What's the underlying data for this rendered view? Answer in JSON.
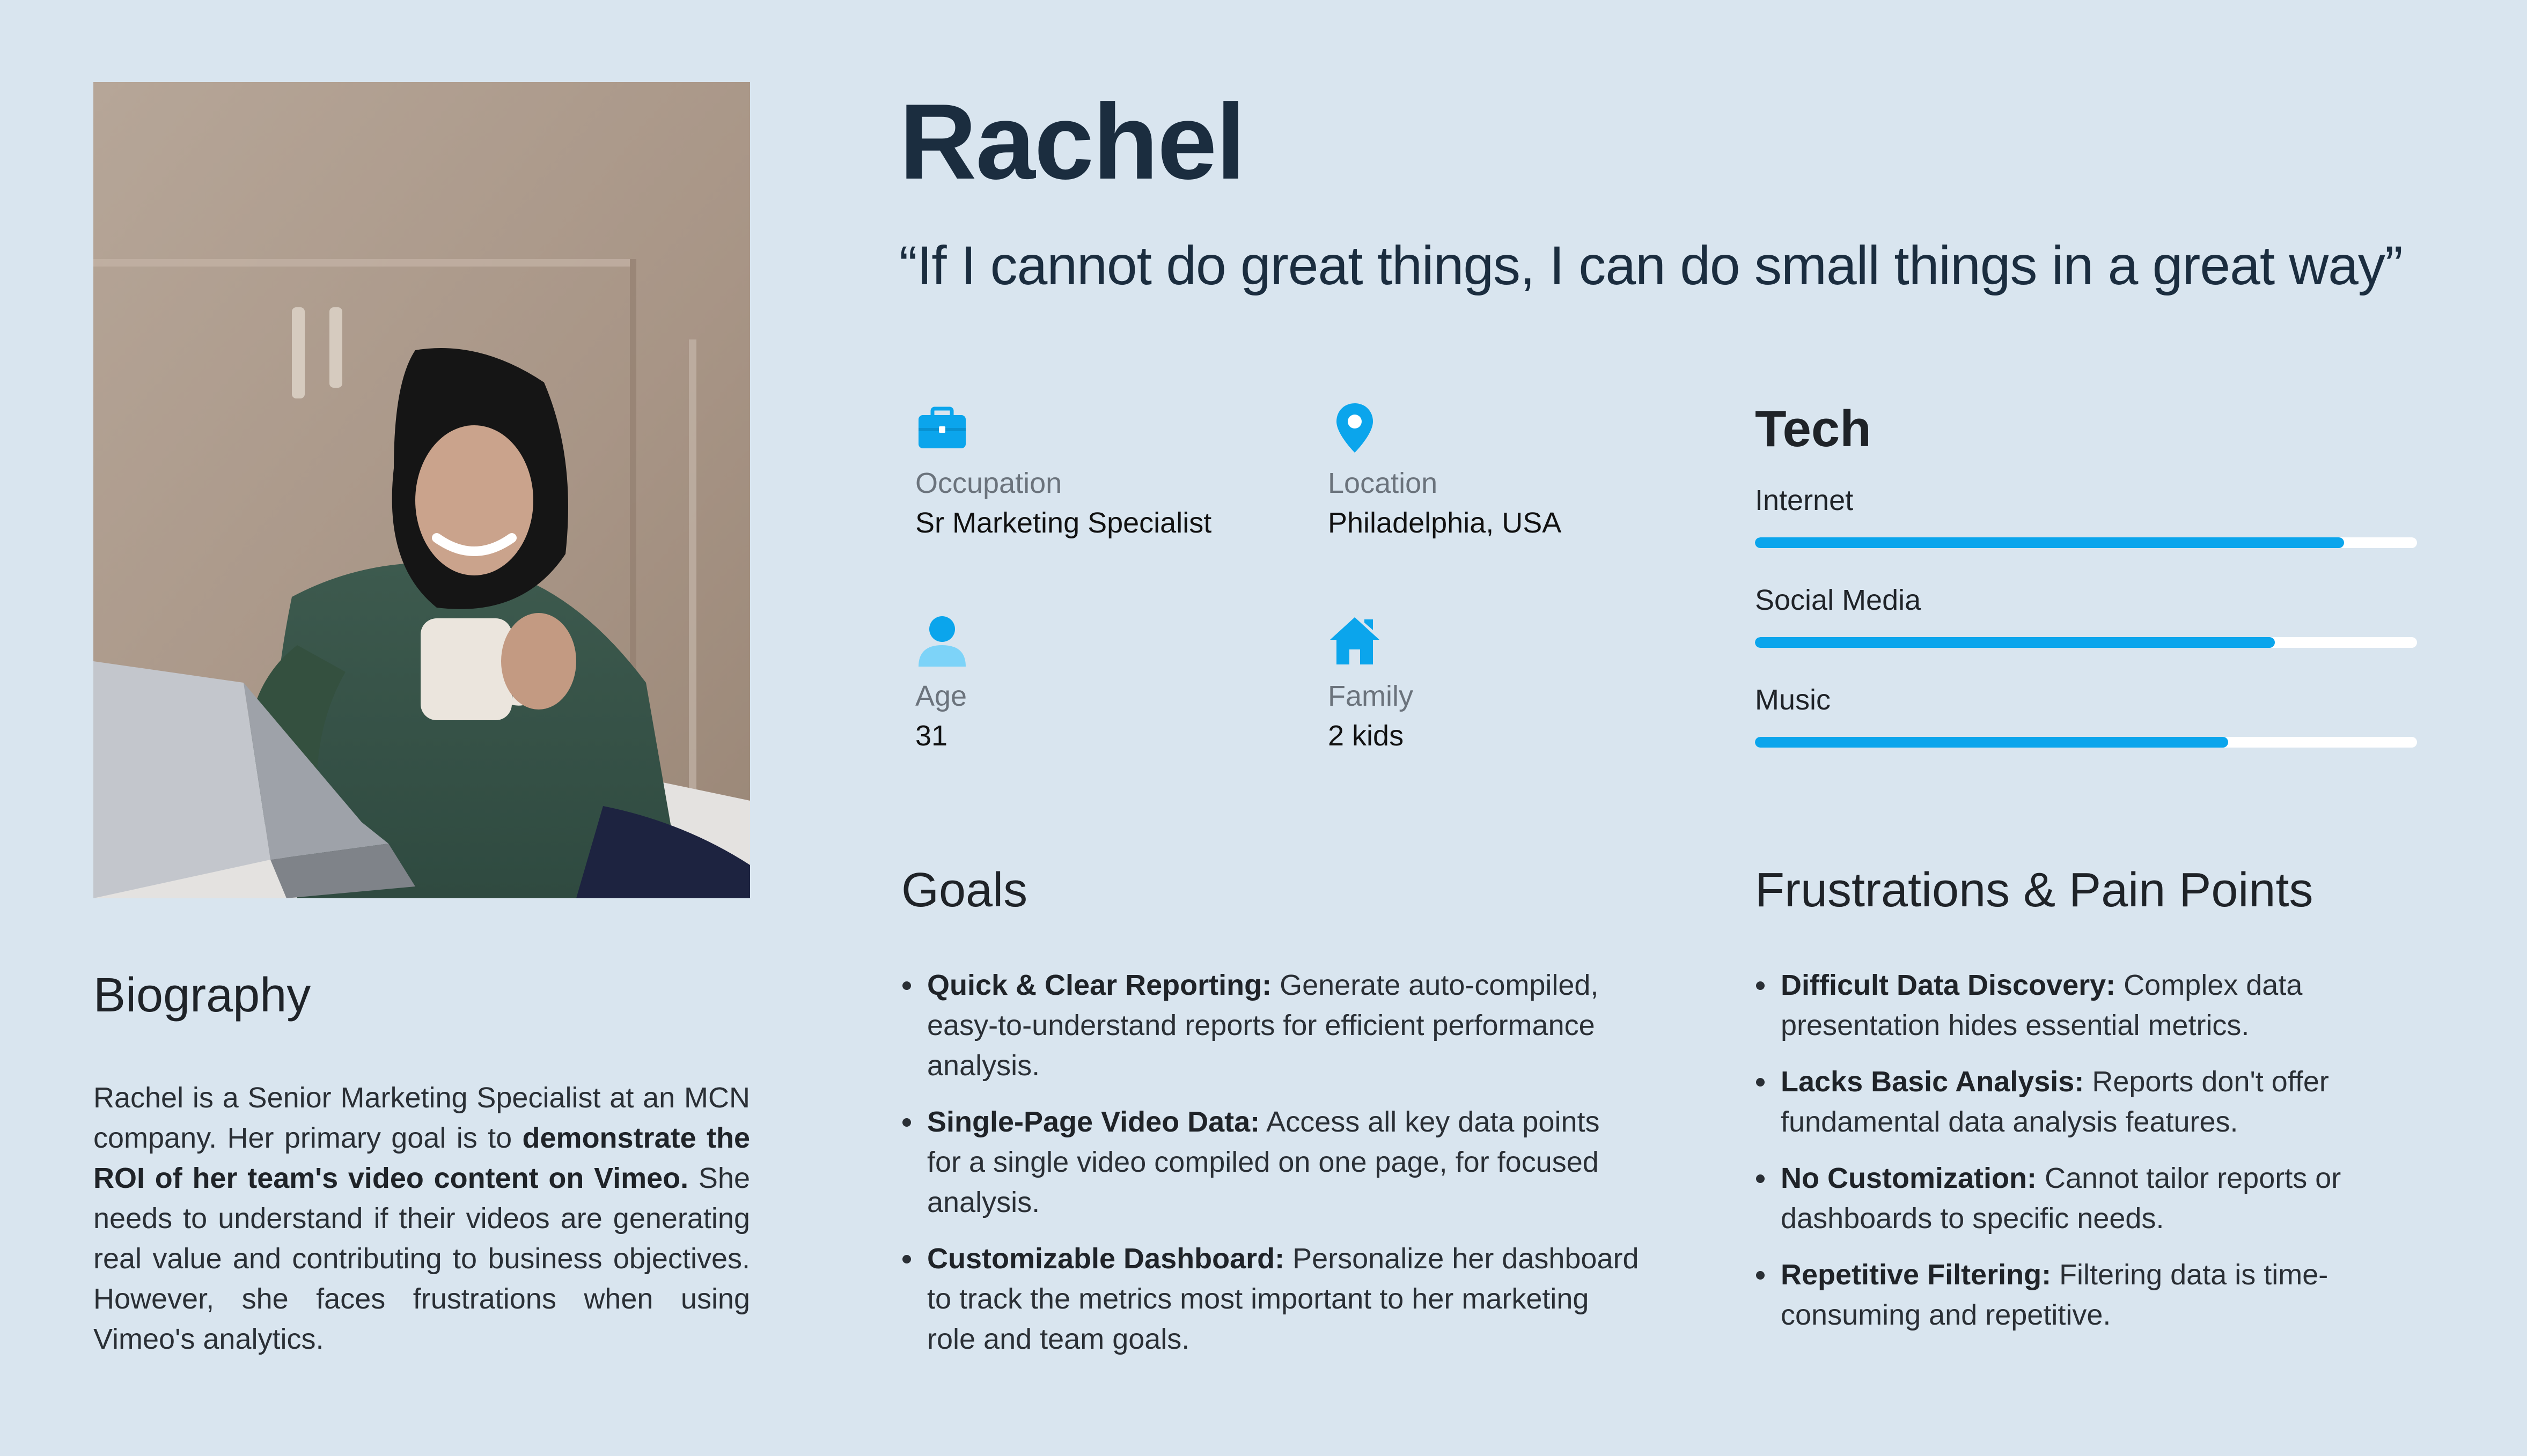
{
  "persona": {
    "name": "Rachel",
    "quote": "“If I cannot do great things, I can do small things in a great way”"
  },
  "info": {
    "occupation": {
      "icon": "briefcase-icon",
      "label": "Occupation",
      "value": "Sr Marketing Specialist"
    },
    "location": {
      "icon": "map-pin-icon",
      "label": "Location",
      "value": "Philadelphia, USA"
    },
    "age": {
      "icon": "person-icon",
      "label": "Age",
      "value": "31"
    },
    "family": {
      "icon": "home-icon",
      "label": "Family",
      "value": "2 kids"
    }
  },
  "tech": {
    "title": "Tech",
    "items": [
      {
        "label": "Internet",
        "level": 0.89
      },
      {
        "label": "Social Media",
        "level": 0.785
      },
      {
        "label": "Music",
        "level": 0.715
      }
    ]
  },
  "biography": {
    "title": "Biography",
    "text_1": "Rachel is a Senior Marketing Specialist at an MCN company.  Her primary goal is to ",
    "text_bold": "demonstrate the ROI of her team's video content on Vimeo.",
    "text_2": " She needs to understand if their videos are generating real value and contributing to business objectives. However, she faces frustrations when using Vimeo's analytics."
  },
  "goals": {
    "title": "Goals",
    "items": [
      {
        "title": "Quick & Clear Reporting:",
        "text": " Generate auto-compiled, easy-to-understand reports for efficient performance analysis."
      },
      {
        "title": "Single-Page Video Data:",
        "text": " Access all key data points for a single video compiled on one page, for focused analysis."
      },
      {
        "title": "Customizable Dashboard:",
        "text": "  Personalize her dashboard to track the metrics most important to her marketing role and team goals."
      }
    ]
  },
  "frustrations": {
    "title": "Frustrations & Pain Points",
    "items": [
      {
        "title": "Difficult Data Discovery:",
        "text": "  Complex data presentation hides essential metrics."
      },
      {
        "title": "Lacks Basic Analysis:",
        "text": "  Reports don't offer fundamental data analysis features."
      },
      {
        "title": "No Customization:",
        "text": "  Cannot tailor reports or dashboards to specific needs."
      },
      {
        "title": "Repetitive Filtering:",
        "text": "  Filtering data is time-consuming and repetitive."
      }
    ]
  },
  "colors": {
    "background": "#d9e5ef",
    "accent": "#0ba5ec",
    "heading": "#1b2d3f"
  }
}
